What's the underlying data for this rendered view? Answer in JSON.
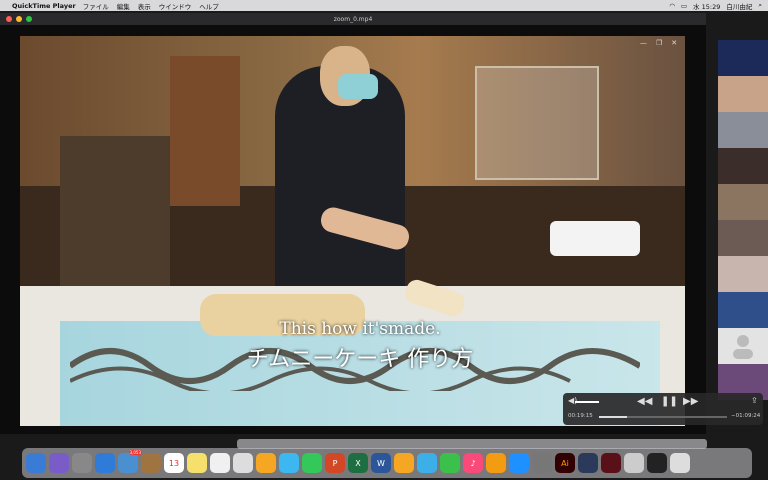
{
  "menubar": {
    "app": "QuickTime Player",
    "menus": [
      "ファイル",
      "編集",
      "表示",
      "ウインドウ",
      "ヘルプ"
    ],
    "clock": "水 15:29",
    "user": "白川由紀"
  },
  "window": {
    "title": "zoom_0.mp4"
  },
  "video": {
    "subtitle_en": "This how it'smade.",
    "subtitle_ja": "チムニーケーキ 作り方"
  },
  "player": {
    "elapsed": "00:19:15",
    "remaining": "−01:09:24",
    "progress": 0.22,
    "volume": 0.6
  },
  "dock": {
    "calendar_day": "13",
    "mail_badge": "3,053"
  },
  "colors": {
    "menubar": "#d9d9dc",
    "window": "#0c0c0c",
    "accent": "#ffffff"
  },
  "icons": [
    "apple-icon",
    "wifi-icon",
    "battery-icon",
    "search-icon",
    "play-pause-icon",
    "rewind-icon",
    "forward-icon",
    "volume-icon",
    "share-icon"
  ]
}
